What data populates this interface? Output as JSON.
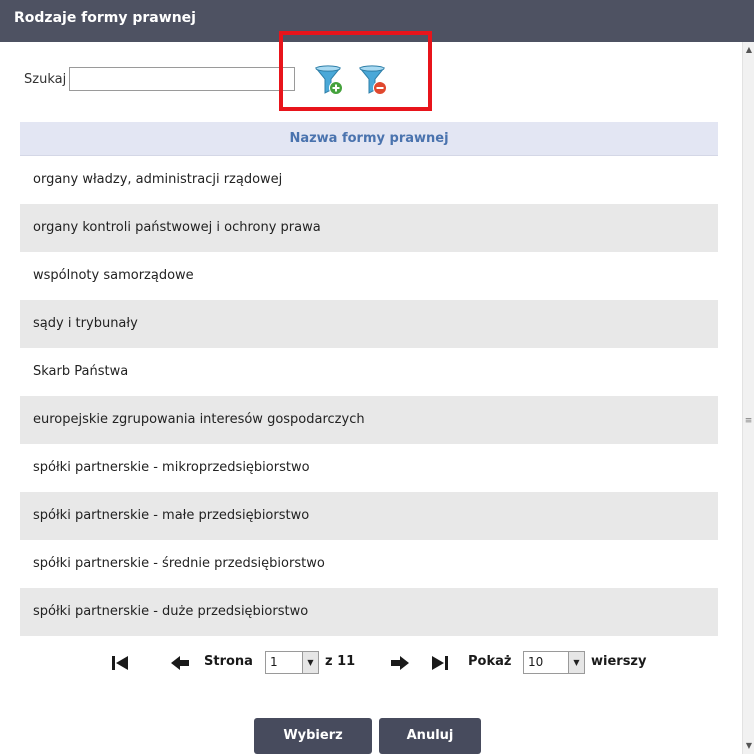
{
  "dialog": {
    "title": "Rodzaje formy prawnej"
  },
  "search": {
    "label": "Szukaj",
    "value": "",
    "placeholder": ""
  },
  "filters": {
    "add_icon": "filter-add-icon",
    "remove_icon": "filter-remove-icon"
  },
  "table": {
    "column_header": "Nazwa formy prawnej",
    "rows": [
      "organy władzy, administracji rządowej",
      "organy kontroli państwowej i ochrony prawa",
      "wspólnoty samorządowe",
      "sądy i trybunały",
      "Skarb Państwa",
      "europejskie zgrupowania interesów gospodarczych",
      "spółki partnerskie - mikroprzedsiębiorstwo",
      "spółki partnerskie - małe przedsiębiorstwo",
      "spółki partnerskie - średnie przedsiębiorstwo",
      "spółki partnerskie - duże przedsiębiorstwo"
    ]
  },
  "pager": {
    "page_label": "Strona",
    "page_value": "1",
    "of_label": "z 11",
    "show_label": "Pokaż",
    "rows_per_page": "10",
    "rows_label": "wierszy"
  },
  "buttons": {
    "select": "Wybierz",
    "cancel": "Anuluj"
  },
  "colors": {
    "titlebar": "#4e5262",
    "header_bg": "#e3e6f3",
    "header_text": "#4a73ae",
    "row_alt": "#e8e8e8",
    "highlight": "#e8141b",
    "button_bg": "#474b5d"
  }
}
